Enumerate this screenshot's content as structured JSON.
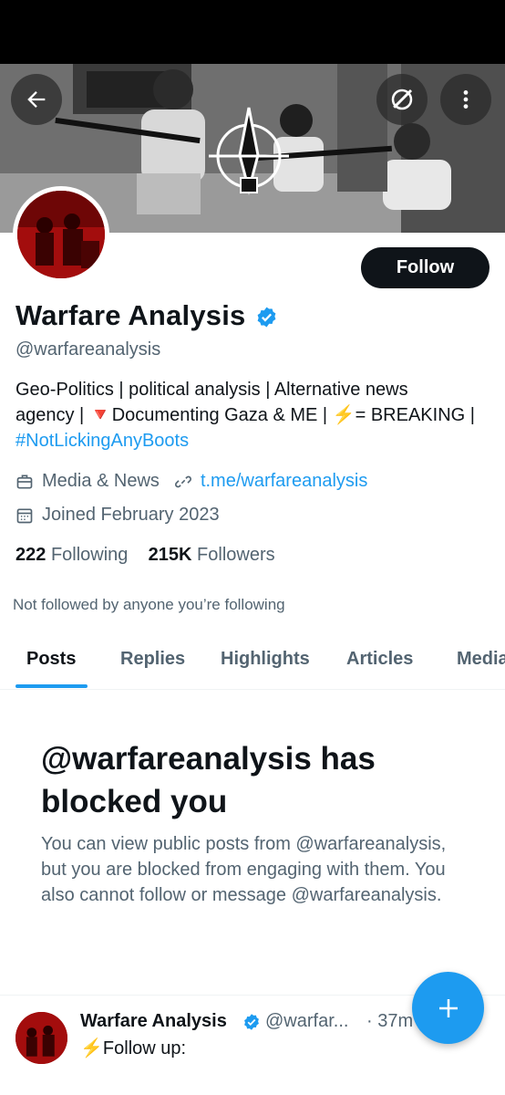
{
  "header": {
    "back_icon": "arrow-left-icon",
    "grok_icon": "grok-icon",
    "more_icon": "more-vertical-icon"
  },
  "profile": {
    "name": "Warfare Analysis",
    "handle": "@warfareanalysis",
    "verified": true,
    "follow_label": "Follow",
    "bio_line1": "Geo-Politics | political analysis | Alternative news",
    "bio_line2_a": "agency | ",
    "bio_triangle": "🔻",
    "bio_line2_b": "Documenting Gaza & ME | ",
    "bio_bolt": "⚡",
    "bio_line2_c": "= BREAKING |",
    "bio_hashtag": "#NotLickingAnyBoots",
    "category": "Media & News",
    "link": "t.me/warfareanalysis",
    "joined": "Joined February 2023",
    "following_count": "222",
    "following_label": "Following",
    "followers_count": "215K",
    "followers_label": "Followers",
    "not_followed": "Not followed by anyone you’re following"
  },
  "tabs": [
    {
      "label": "Posts",
      "active": true
    },
    {
      "label": "Replies",
      "active": false
    },
    {
      "label": "Highlights",
      "active": false
    },
    {
      "label": "Articles",
      "active": false
    },
    {
      "label": "Media",
      "active": false
    }
  ],
  "blocked": {
    "title": "@warfareanalysis has blocked you",
    "text": "You can view public posts from @warfareanalysis, but you are blocked from engaging with them. You also cannot follow or message @warfareanalysis."
  },
  "post": {
    "name": "Warfare Analysis",
    "handle": "@warfar...",
    "time": "· 37m",
    "text_icon": "⚡",
    "text": "Follow up:"
  },
  "fab": {
    "icon": "plus-icon"
  },
  "colors": {
    "accent": "#1d9bf0",
    "text": "#0f1419",
    "secondary": "#536471",
    "button_dark": "#0f1419"
  }
}
